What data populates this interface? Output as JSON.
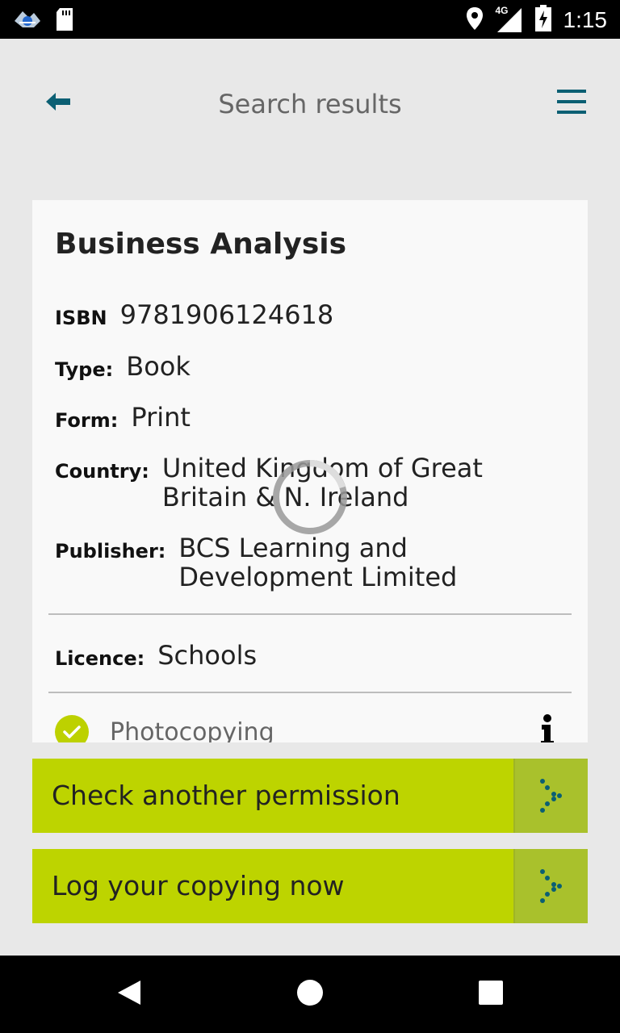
{
  "status_bar": {
    "time": "1:15",
    "network": "4G",
    "icons": [
      "app-notification-icon",
      "sd-card-icon",
      "location-icon",
      "signal-icon",
      "battery-charging-icon"
    ]
  },
  "header": {
    "title": "Search results",
    "back_icon": "back-arrow-icon",
    "menu_icon": "hamburger-menu-icon"
  },
  "result": {
    "title": "Business Analysis",
    "fields": {
      "isbn": {
        "label": "ISBN",
        "value": "9781906124618"
      },
      "type": {
        "label": "Type:",
        "value": "Book"
      },
      "form": {
        "label": "Form:",
        "value": "Print"
      },
      "country": {
        "label": "Country:",
        "value_line1": "United Kingdom of Great",
        "value_line2": "Britain & N. Ireland"
      },
      "publisher": {
        "label": "Publisher:",
        "value_line1": "BCS Learning and",
        "value_line2": "Development Limited"
      }
    },
    "licence": {
      "label": "Licence:",
      "value": "Schools"
    },
    "permission": {
      "label": "Photocopying",
      "status_icon": "check-circle-icon",
      "info_icon": "info-icon"
    }
  },
  "actions": {
    "check_another": "Check another permission",
    "log_copying": "Log your copying now"
  },
  "colors": {
    "accent": "#bdd400",
    "accent_dark": "#a9c12c",
    "teal": "#0b5f73"
  }
}
